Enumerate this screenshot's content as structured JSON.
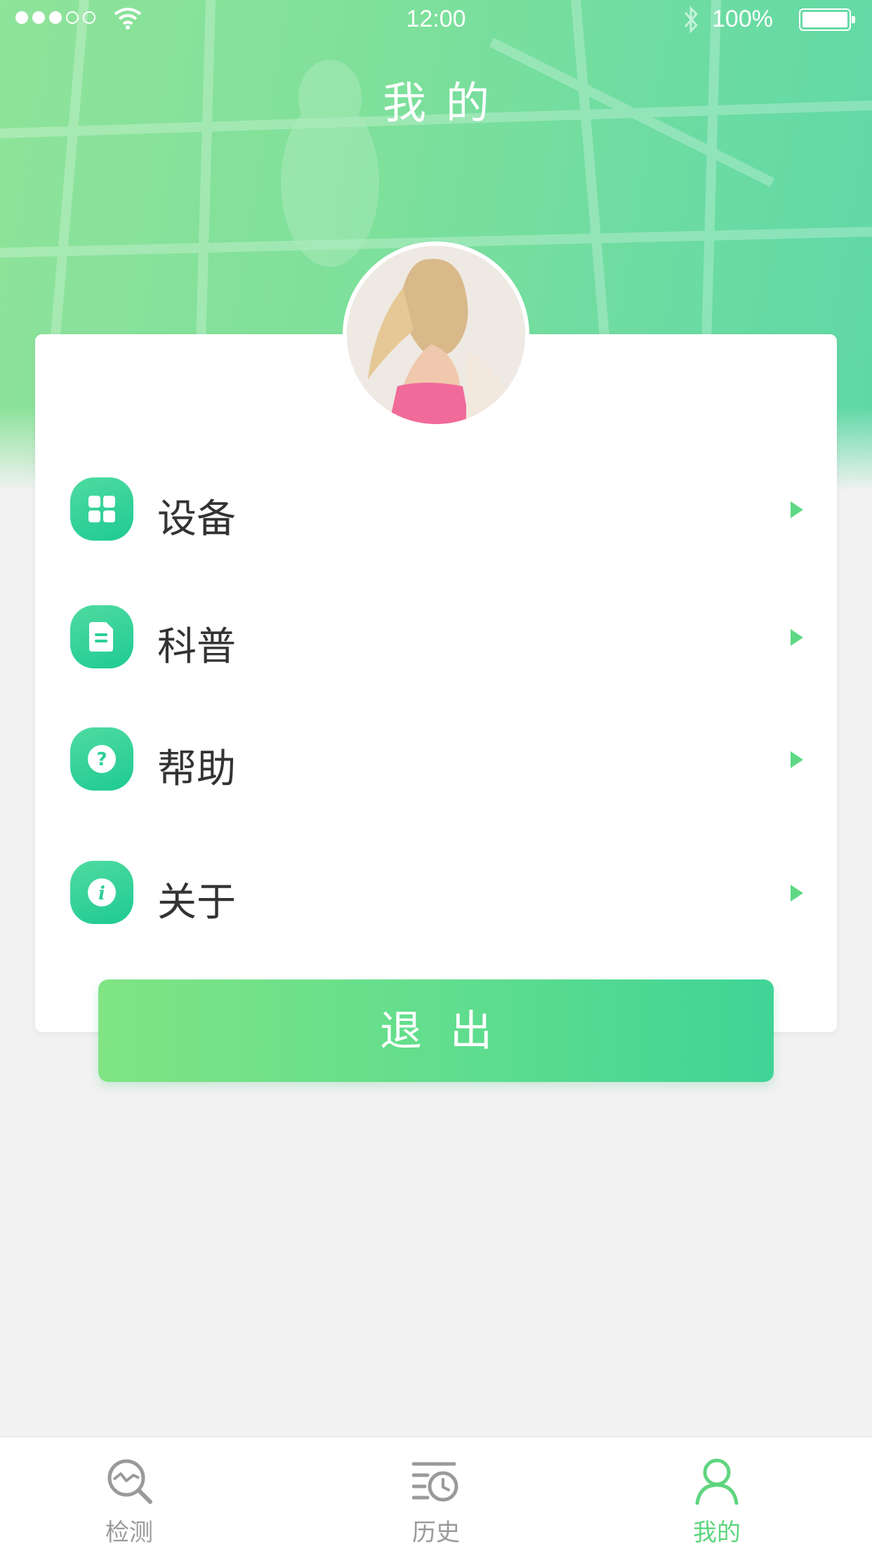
{
  "status_bar": {
    "time": "12:00",
    "battery": "100%"
  },
  "header": {
    "title": "我的"
  },
  "menu": {
    "items": [
      {
        "label": "设备",
        "icon": "grid-icon"
      },
      {
        "label": "科普",
        "icon": "document-icon"
      },
      {
        "label": "帮助",
        "icon": "help-icon"
      },
      {
        "label": "关于",
        "icon": "info-icon"
      }
    ]
  },
  "logout": {
    "label": "退出"
  },
  "tabbar": {
    "tabs": [
      {
        "label": "检测",
        "icon": "detect-icon",
        "active": false
      },
      {
        "label": "历史",
        "icon": "history-icon",
        "active": false
      },
      {
        "label": "我的",
        "icon": "profile-icon",
        "active": true
      }
    ]
  },
  "colors": {
    "accent": "#5fd57f",
    "icon_gradient_start": "#4fdba0",
    "icon_gradient_end": "#1fca94",
    "inactive_tab": "#9a9a9a"
  }
}
